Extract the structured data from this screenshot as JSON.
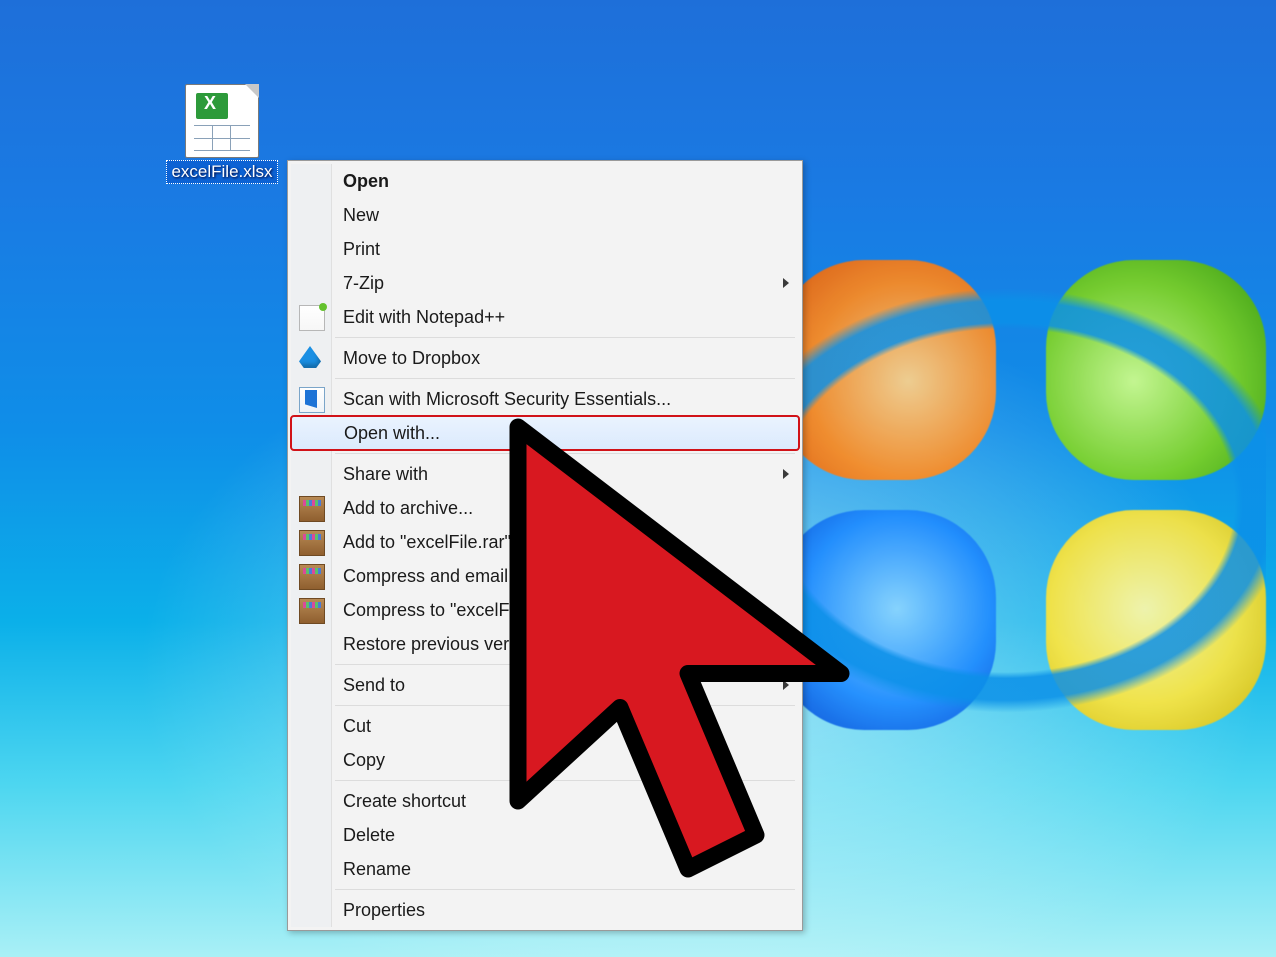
{
  "file": {
    "name": "excelFile.xlsx"
  },
  "menu": {
    "highlighted_index": 7,
    "items": [
      {
        "label": "Open",
        "bold": true
      },
      {
        "label": "New"
      },
      {
        "label": "Print"
      },
      {
        "label": "7-Zip",
        "submenu": true
      },
      {
        "label": "Edit with Notepad++",
        "icon": "notepadpp-icon"
      },
      {
        "sep": true
      },
      {
        "label": "Move to Dropbox",
        "icon": "dropbox-icon"
      },
      {
        "sep": true
      },
      {
        "label": "Scan with Microsoft Security Essentials...",
        "icon": "mse-icon"
      },
      {
        "label": "Open with...",
        "highlight": true
      },
      {
        "sep": true
      },
      {
        "label": "Share with",
        "submenu": true
      },
      {
        "label": "Add to archive...",
        "icon": "winrar-icon"
      },
      {
        "label": "Add to \"excelFile.rar\"",
        "icon": "winrar-icon"
      },
      {
        "label": "Compress and email...",
        "icon": "winrar-icon"
      },
      {
        "label": "Compress to \"excelFile.rar\" and email",
        "icon": "winrar-icon"
      },
      {
        "label": "Restore previous versions"
      },
      {
        "sep": true
      },
      {
        "label": "Send to",
        "submenu": true
      },
      {
        "sep": true
      },
      {
        "label": "Cut"
      },
      {
        "label": "Copy"
      },
      {
        "sep": true
      },
      {
        "label": "Create shortcut"
      },
      {
        "label": "Delete"
      },
      {
        "label": "Rename"
      },
      {
        "sep": true
      },
      {
        "label": "Properties"
      }
    ]
  }
}
